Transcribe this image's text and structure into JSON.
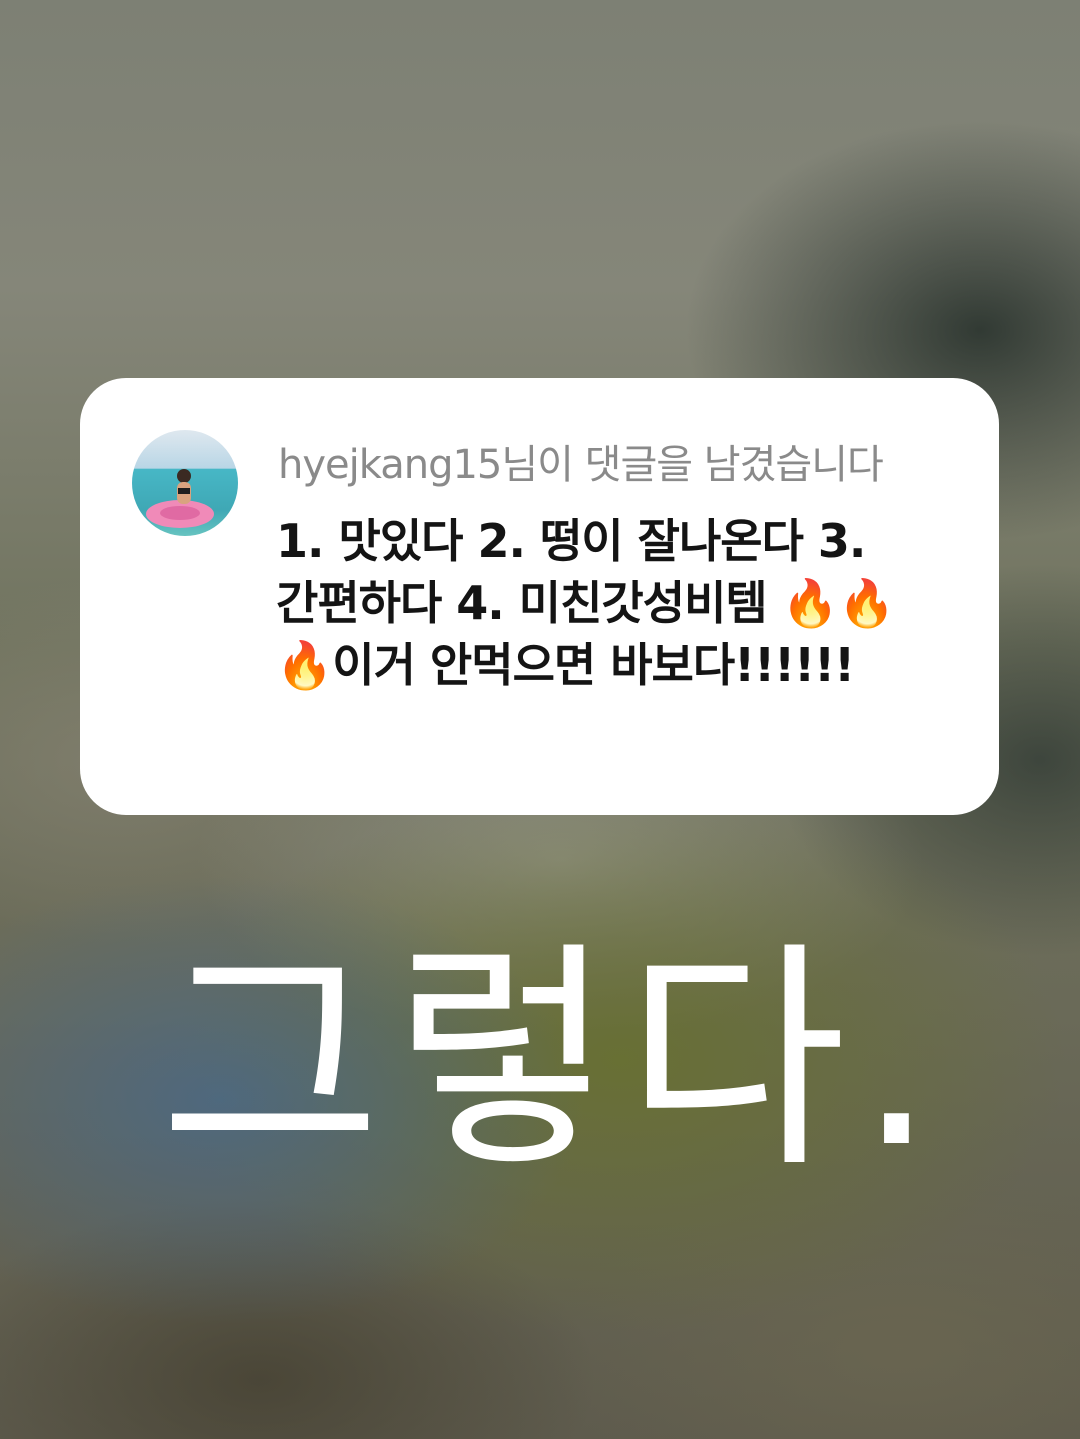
{
  "notification": {
    "header": "hyejkang15님이 댓글을 남겼습니다",
    "comment": "1. 맛있다 2. 떵이 잘나온다 3. 간편하다 4. 미친갓성비템 🔥🔥🔥이거 안먹으면 바보다!!!!!!"
  },
  "overlay_text": "그렇다."
}
